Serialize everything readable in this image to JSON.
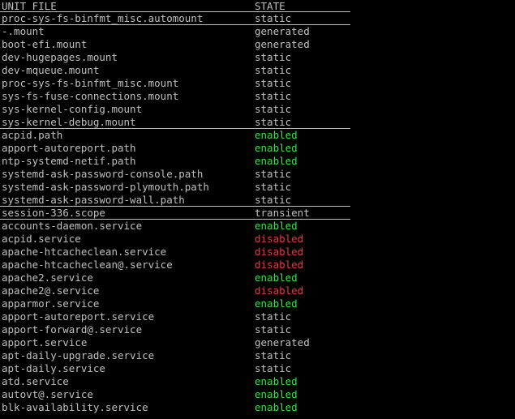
{
  "header": {
    "unit_label": "UNIT FILE",
    "state_label": "STATE"
  },
  "colors": {
    "background": "#000000",
    "text": "#c0c0c0",
    "enabled": "#33e833",
    "disabled": "#e83a3a"
  },
  "rows": [
    {
      "unit": "proc-sys-fs-binfmt_misc.automount",
      "state": "static"
    },
    {
      "unit": "-.mount",
      "state": "generated"
    },
    {
      "unit": "boot-efi.mount",
      "state": "generated"
    },
    {
      "unit": "dev-hugepages.mount",
      "state": "static"
    },
    {
      "unit": "dev-mqueue.mount",
      "state": "static"
    },
    {
      "unit": "proc-sys-fs-binfmt_misc.mount",
      "state": "static"
    },
    {
      "unit": "sys-fs-fuse-connections.mount",
      "state": "static"
    },
    {
      "unit": "sys-kernel-config.mount",
      "state": "static"
    },
    {
      "unit": "sys-kernel-debug.mount",
      "state": "static"
    },
    {
      "unit": "acpid.path",
      "state": "enabled"
    },
    {
      "unit": "apport-autoreport.path",
      "state": "enabled"
    },
    {
      "unit": "ntp-systemd-netif.path",
      "state": "enabled"
    },
    {
      "unit": "systemd-ask-password-console.path",
      "state": "static"
    },
    {
      "unit": "systemd-ask-password-plymouth.path",
      "state": "static"
    },
    {
      "unit": "systemd-ask-password-wall.path",
      "state": "static"
    },
    {
      "unit": "session-336.scope",
      "state": "transient"
    },
    {
      "unit": "accounts-daemon.service",
      "state": "enabled"
    },
    {
      "unit": "acpid.service",
      "state": "disabled"
    },
    {
      "unit": "apache-htcacheclean.service",
      "state": "disabled"
    },
    {
      "unit": "apache-htcacheclean@.service",
      "state": "disabled"
    },
    {
      "unit": "apache2.service",
      "state": "enabled"
    },
    {
      "unit": "apache2@.service",
      "state": "disabled"
    },
    {
      "unit": "apparmor.service",
      "state": "enabled"
    },
    {
      "unit": "apport-autoreport.service",
      "state": "static"
    },
    {
      "unit": "apport-forward@.service",
      "state": "static"
    },
    {
      "unit": "apport.service",
      "state": "generated"
    },
    {
      "unit": "apt-daily-upgrade.service",
      "state": "static"
    },
    {
      "unit": "apt-daily.service",
      "state": "static"
    },
    {
      "unit": "atd.service",
      "state": "enabled"
    },
    {
      "unit": "autovt@.service",
      "state": "enabled"
    },
    {
      "unit": "blk-availability.service",
      "state": "enabled"
    }
  ]
}
